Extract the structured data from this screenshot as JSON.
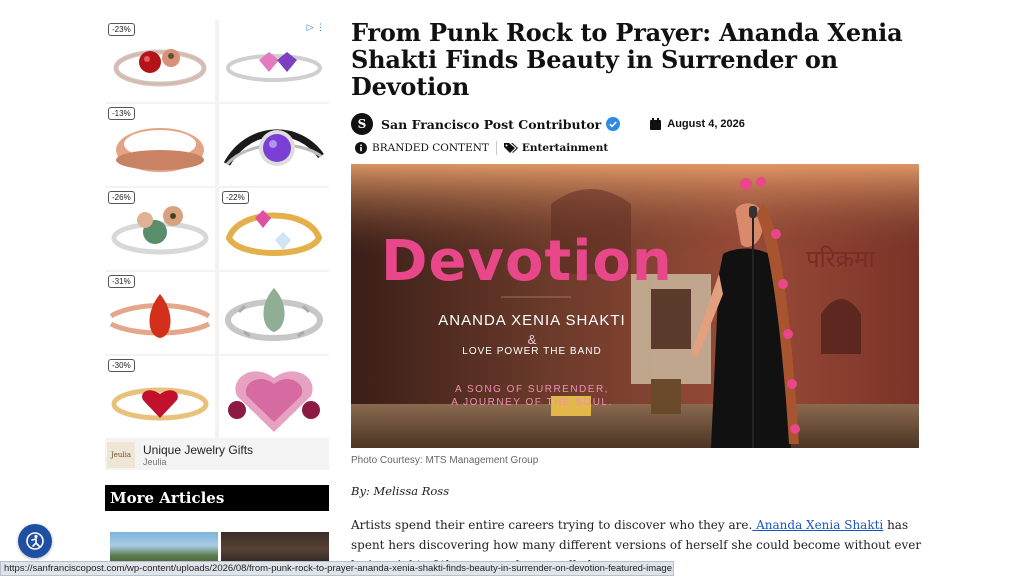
{
  "ad": {
    "adchoices_label": "▷ ⋮",
    "tiles": [
      {
        "discount": "-23%"
      },
      {
        "discount": ""
      },
      {
        "discount": "-13%"
      },
      {
        "discount": ""
      },
      {
        "discount": "-26%"
      },
      {
        "discount": "-22%"
      },
      {
        "discount": "-31%"
      },
      {
        "discount": ""
      },
      {
        "discount": "-30%"
      },
      {
        "discount": ""
      }
    ],
    "brand_logo": "Jeulia",
    "brand_title": "Unique Jewelry Gifts",
    "brand_sub": "Jeulia"
  },
  "sidebar": {
    "more_articles": "More Articles"
  },
  "article": {
    "title": "From Punk Rock to Prayer: Ananda Xenia Shakti Finds Beauty in Surrender on Devotion",
    "author_avatar": "S",
    "author": "San Francisco Post Contributor",
    "date": "August 4, 2026",
    "label": "BRANDED CONTENT",
    "category": "Entertainment",
    "hero": {
      "title": "Devotion",
      "artist": "ANANDA XENIA SHAKTI",
      "amp": "&",
      "band": "LOVE POWER THE BAND",
      "tagline1": "A SONG OF SURRENDER,",
      "tagline2": "A JOURNEY OF THE SOUL.",
      "sign": "परिक्रमा"
    },
    "caption": "Photo Courtesy: MTS Management Group",
    "byline": "By: Melissa Ross",
    "body_before_link": "Artists spend their entire careers trying to discover who they are.",
    "body_link": " Ananda Xenia Shakti",
    "body_after_link": " has spent hers discovering how many different versions of herself she could become without ever losing sight of the person she was all along."
  },
  "status_bar": {
    "url": "https://sanfranciscopost.com/wp-content/uploads/2026/08/from-punk-rock-to-prayer-ananda-xenia-shakti-finds-beauty-in-surrender-on-devotion-featured-image.jpg"
  },
  "colors": {
    "accent_pink": "#e8478a",
    "link_blue": "#1a56c4",
    "a11y_blue": "#1e4fa3"
  }
}
